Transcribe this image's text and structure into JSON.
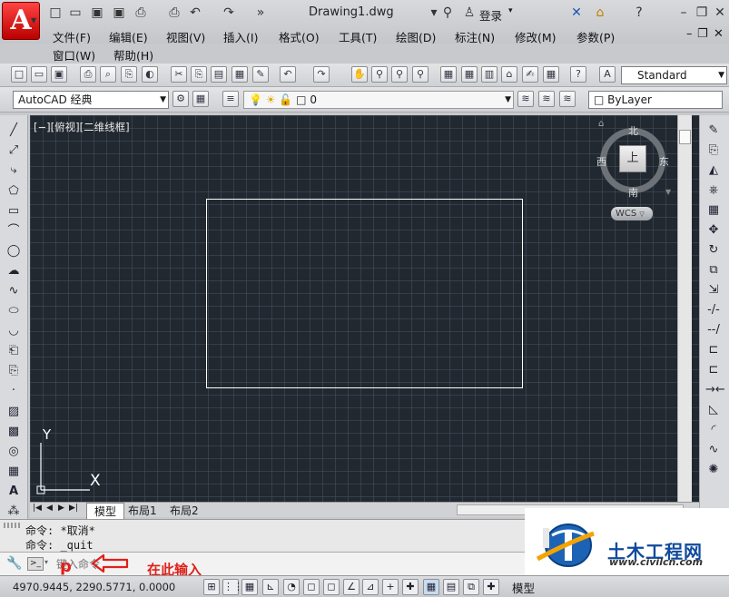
{
  "app": {
    "logo": "A",
    "doc_title": "Drawing1.dwg",
    "login": "登录"
  },
  "menus": [
    "文件(F)",
    "编辑(E)",
    "视图(V)",
    "插入(I)",
    "格式(O)",
    "工具(T)",
    "绘图(D)",
    "标注(N)",
    "修改(M)",
    "参数(P)",
    "窗口(W)",
    "帮助(H)"
  ],
  "toolbars": {
    "style_combo": "Standard",
    "workspace_combo": "AutoCAD 经典",
    "layer_combo": "0",
    "color_combo": "ByLayer"
  },
  "viewport": {
    "label": "[−][俯视][二维线框]",
    "viewcube": {
      "face": "上",
      "north": "北",
      "south": "南",
      "east": "东",
      "west": "西",
      "wcs": "WCS"
    },
    "ucs_x": "X",
    "ucs_y": "Y"
  },
  "layout_tabs": [
    "模型",
    "布局1",
    "布局2"
  ],
  "command": {
    "history": [
      "命令: *取消*",
      "命令: _quit"
    ],
    "input_placeholder": "键入命令",
    "typed": "p",
    "annotation": "在此输入"
  },
  "status": {
    "coords": "4970.9445, 2290.5771, 0.0000",
    "model_label": "模型"
  },
  "watermark": {
    "title": "土木工程网",
    "url": "www.civilcn.com"
  },
  "colors": {
    "canvas_bg": "#212830",
    "accent_red": "#e0201a",
    "rect_line": "#ffffff"
  }
}
